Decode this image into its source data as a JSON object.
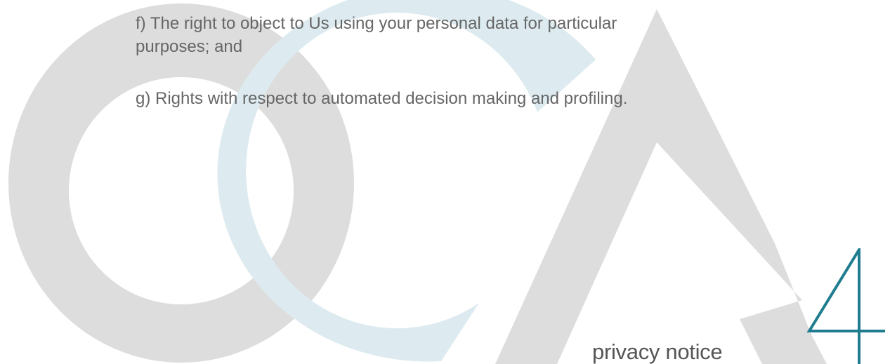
{
  "body": {
    "items": [
      "f) The right to object to Us using your personal data for particular purposes; and",
      "g) Rights with respect to automated decision making and profiling."
    ]
  },
  "footer": {
    "label": "privacy notice",
    "page_number": "4"
  },
  "logo": {
    "letters": "OCA"
  },
  "colors": {
    "logo_grey": "#dddddd",
    "logo_blue": "#ddebf0",
    "text": "#666666",
    "footer_text": "#555555",
    "accent": "#1f7d8f"
  }
}
